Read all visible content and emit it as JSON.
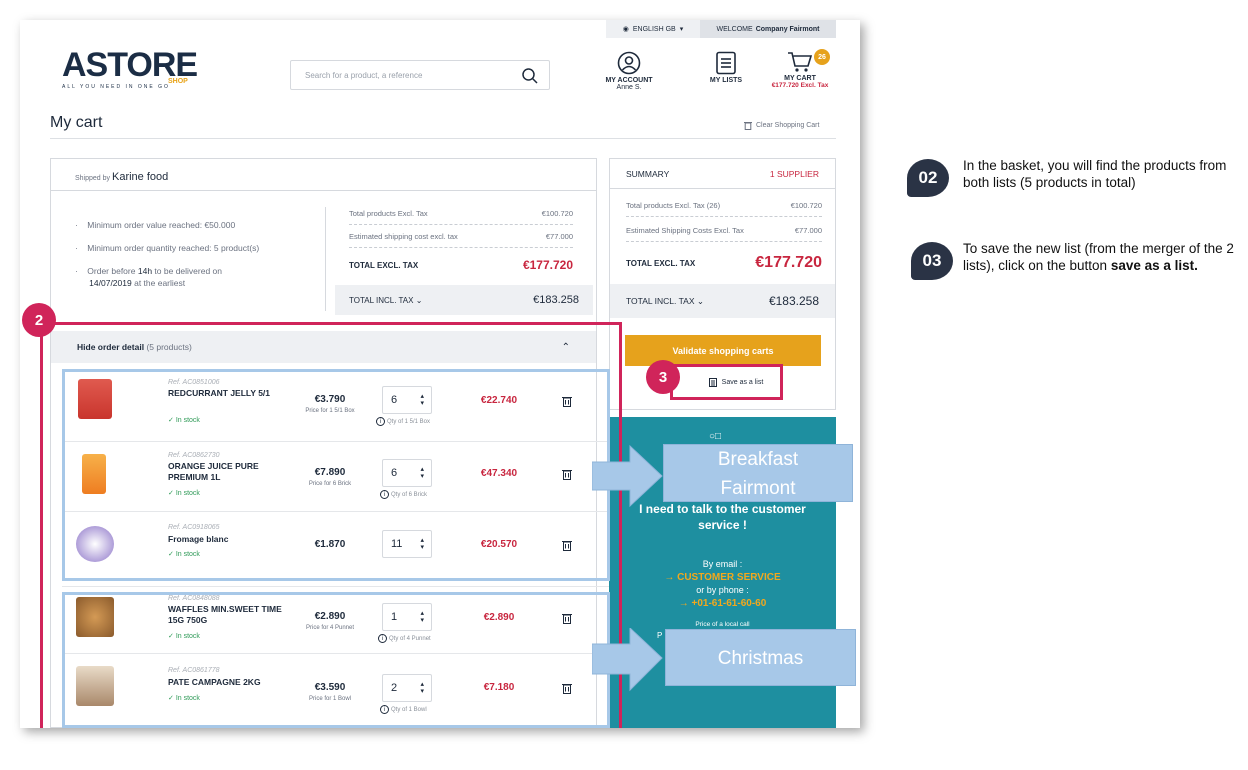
{
  "topbar": {
    "language": "ENGLISH GB",
    "welcome_prefix": "WELCOME",
    "welcome_name": "Company Fairmont"
  },
  "logo": {
    "brand": "ASTORE",
    "shop": "SHOP",
    "tagline": "ALL YOU NEED IN ONE GO"
  },
  "search": {
    "placeholder": "Search for a product, a reference"
  },
  "header": {
    "account_label": "MY ACCOUNT",
    "account_user": "Anne S.",
    "lists_label": "MY LISTS",
    "cart_label": "MY CART",
    "cart_amount": "€177.720 Excl. Tax",
    "cart_count": "26"
  },
  "page": {
    "title": "My cart",
    "clear_cart": "Clear Shopping Cart"
  },
  "supplier": {
    "shipped_by_prefix": "Shipped by",
    "shipped_by_name": "Karine food",
    "conditions": [
      "Minimum order value reached: €50.000",
      "Minimum order quantity reached: 5 product(s)"
    ],
    "order_before_prefix": "Order before",
    "order_before_time": "14h",
    "order_before_mid": "to be delivered on",
    "order_before_date": "14/07/2019",
    "order_before_suffix": "at the earliest",
    "totals": {
      "products_label": "Total products Excl. Tax",
      "products_value": "€100.720",
      "shipping_label": "Estimated shipping cost excl. tax",
      "shipping_value": "€77.000",
      "excl_label": "TOTAL EXCL. TAX",
      "excl_value": "€177.720",
      "incl_label": "TOTAL INCL. TAX",
      "incl_value": "€183.258"
    },
    "detail_toggle": "Hide order detail",
    "detail_count": "(5 products)"
  },
  "products": [
    {
      "ref": "Ref. AC0851006",
      "name": "REDCURRANT JELLY 5/1",
      "stock": "In stock",
      "price": "€3.790",
      "unit": "Price for 1 5/1 Box",
      "qty": "6",
      "qty_note": "Qty of 1 5/1 Box",
      "total": "€22.740"
    },
    {
      "ref": "Ref. AC0862730",
      "name": "ORANGE JUICE PURE PREMIUM 1L",
      "stock": "In stock",
      "price": "€7.890",
      "unit": "Price for 6 Brick",
      "qty": "6",
      "qty_note": "Qty of 6 Brick",
      "total": "€47.340"
    },
    {
      "ref": "Ref. AC0918065",
      "name": "Fromage blanc",
      "stock": "In stock",
      "price": "€1.870",
      "unit": "",
      "qty": "11",
      "qty_note": "",
      "total": "€20.570"
    },
    {
      "ref": "Ref. AC0848088",
      "name": "WAFFLES MIN.SWEET TIME 15G 750G",
      "stock": "In stock",
      "price": "€2.890",
      "unit": "Price for 4 Punnet",
      "qty": "1",
      "qty_note": "Qty of 4 Punnet",
      "total": "€2.890"
    },
    {
      "ref": "Ref. AC0861778",
      "name": "PATE CAMPAGNE 2KG",
      "stock": "In stock",
      "price": "€3.590",
      "unit": "Price for 1 Bowl",
      "qty": "2",
      "qty_note": "Qty of 1 Bowl",
      "total": "€7.180"
    }
  ],
  "summary": {
    "title": "SUMMARY",
    "supplier_count": "1 SUPPLIER",
    "products_label": "Total products Excl. Tax (26)",
    "products_value": "€100.720",
    "shipping_label": "Estimated Shipping Costs Excl. Tax",
    "shipping_value": "€77.000",
    "excl_label": "TOTAL EXCL. TAX",
    "excl_value": "€177.720",
    "incl_label": "TOTAL INCL. TAX",
    "incl_value": "€183.258",
    "validate_label": "Validate shopping carts",
    "save_list_label": "Save as a list"
  },
  "service": {
    "heading": "I need to talk to the customer service !",
    "by_email": "By email :",
    "email_link": "CUSTOMER SERVICE",
    "by_phone": "or by phone :",
    "phone": "+01-61-61-60-60",
    "call_note": "Price of a local call",
    "trailing": "P"
  },
  "annotations": {
    "marker_2": "2",
    "marker_3": "3",
    "callout_breakfast_1": "Breakfast",
    "callout_breakfast_2": "Fairmont",
    "callout_christmas": "Christmas",
    "step_02_num": "02",
    "step_02_text": "In the basket, you will find the products from both lists (5 products in total)",
    "step_03_num": "03",
    "step_03_text_a": "To save the new list (from the merger of the 2 lists), click on the button",
    "step_03_bold": "save as a list."
  },
  "colors": {
    "accent": "#e6a21c",
    "red": "#c8263f",
    "teal": "#1e8fa0",
    "highlight_border": "#d0245a",
    "group_border": "#a7c8e8",
    "navy": "#1b2d45"
  }
}
